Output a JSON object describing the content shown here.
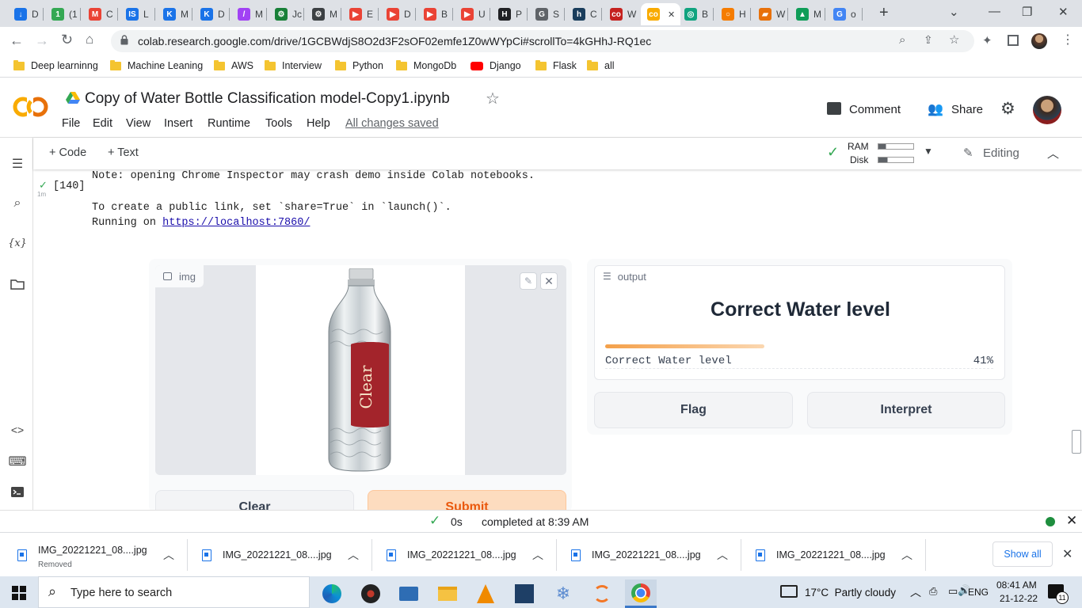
{
  "browser": {
    "tabs": [
      {
        "label": "D",
        "color": "#1a73e8",
        "glyph": "↓"
      },
      {
        "label": "(1",
        "color": "#34a853",
        "glyph": "1"
      },
      {
        "label": "C",
        "color": "#ea4335",
        "glyph": "M"
      },
      {
        "label": "L",
        "color": "#1a73e8",
        "glyph": "IS"
      },
      {
        "label": "M",
        "color": "#1a73e8",
        "glyph": "K"
      },
      {
        "label": "D",
        "color": "#1a73e8",
        "glyph": "K"
      },
      {
        "label": "M",
        "color": "#a142f4",
        "glyph": "/"
      },
      {
        "label": "Jc",
        "color": "#188038",
        "glyph": "⚙"
      },
      {
        "label": "M",
        "color": "#3c4043",
        "glyph": "⚙"
      },
      {
        "label": "E",
        "color": "#ea4335",
        "glyph": "▶"
      },
      {
        "label": "D",
        "color": "#ea4335",
        "glyph": "▶"
      },
      {
        "label": "B",
        "color": "#ea4335",
        "glyph": "▶"
      },
      {
        "label": "U",
        "color": "#ea4335",
        "glyph": "▶"
      },
      {
        "label": "P",
        "color": "#202124",
        "glyph": "H"
      },
      {
        "label": "S",
        "color": "#5f6368",
        "glyph": "G"
      },
      {
        "label": "C",
        "color": "#1a3d5c",
        "glyph": "h"
      },
      {
        "label": "W",
        "color": "#c5221f",
        "glyph": "co"
      },
      {
        "label": "",
        "color": "#f9ab00",
        "glyph": "co"
      },
      {
        "label": "B",
        "color": "#10a37f",
        "glyph": "◎"
      },
      {
        "label": "H",
        "color": "#f57c00",
        "glyph": "○"
      },
      {
        "label": "W",
        "color": "#e8710a",
        "glyph": "▰"
      },
      {
        "label": "M",
        "color": "#0f9d58",
        "glyph": "▲"
      },
      {
        "label": "o",
        "color": "#4285f4",
        "glyph": "G"
      }
    ],
    "url": "colab.research.google.com/drive/1GCBWdjS8O2d3F2sOF02emfe1Z0wWYpCi#scrollTo=4kGHhJ-RQ1ec",
    "bookmarks": [
      "Deep learninng",
      "Machine Leaning",
      "AWS",
      "Interview",
      "Python",
      "MongoDb",
      "Django",
      "Flask",
      "all"
    ]
  },
  "colab": {
    "title": "Copy of Water Bottle Classification model-Copy1.ipynb",
    "menu": [
      "File",
      "Edit",
      "View",
      "Insert",
      "Runtime",
      "Tools",
      "Help"
    ],
    "saved": "All changes saved",
    "comment": "Comment",
    "share": "Share",
    "add_code": "+ Code",
    "add_text": "+ Text",
    "ram": "RAM",
    "disk": "Disk",
    "editing": "Editing",
    "cell_number": "[140]",
    "cell_time": "1m",
    "output_lines": {
      "note": "Note: opening Chrome Inspector may crash demo inside Colab notebooks.",
      "public": "To create a public link, set `share=True` in `launch()`.",
      "running": "Running on ",
      "link": "https://localhost:7860/"
    }
  },
  "gradio": {
    "input_label": "img",
    "output_label": "output",
    "bottle_brand": "Clear",
    "result_title": "Correct Water level",
    "confidence_label": "Correct Water level",
    "confidence_pct": "41%",
    "confidence_value": 0.41,
    "clear_button": "Clear",
    "submit_button": "Submit",
    "flag_button": "Flag",
    "interpret_button": "Interpret"
  },
  "status": {
    "elapsed": "0s",
    "completed": "completed at 8:39 AM"
  },
  "downloads": {
    "items": [
      {
        "name": "IMG_20221221_08....jpg",
        "sub": "Removed"
      },
      {
        "name": "IMG_20221221_08....jpg",
        "sub": ""
      },
      {
        "name": "IMG_20221221_08....jpg",
        "sub": ""
      },
      {
        "name": "IMG_20221221_08....jpg",
        "sub": ""
      },
      {
        "name": "IMG_20221221_08....jpg",
        "sub": ""
      }
    ],
    "show_all": "Show all"
  },
  "taskbar": {
    "search_placeholder": "Type here to search",
    "weather": "17°C  Partly cloudy",
    "lang": "ENG",
    "time": "08:41 AM",
    "date": "21-12-22",
    "notif_count": "11"
  }
}
